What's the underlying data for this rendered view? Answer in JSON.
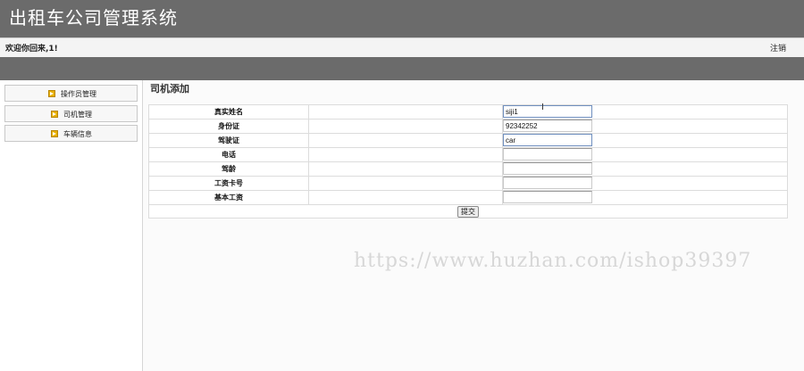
{
  "app": {
    "title": "出租车公司管理系统"
  },
  "welcome": {
    "text": "欢迎你回来,1!",
    "logout_label": "注销"
  },
  "sidebar": {
    "items": [
      {
        "label": "操作员管理"
      },
      {
        "label": "司机管理"
      },
      {
        "label": "车辆信息"
      }
    ]
  },
  "main": {
    "heading": "司机添加",
    "fields": [
      {
        "label": "真实姓名",
        "value": "siji1"
      },
      {
        "label": "身份证",
        "value": "92342252"
      },
      {
        "label": "驾驶证",
        "value": "car"
      },
      {
        "label": "电话",
        "value": ""
      },
      {
        "label": "驾龄",
        "value": ""
      },
      {
        "label": "工资卡号",
        "value": ""
      },
      {
        "label": "基本工资",
        "value": ""
      }
    ],
    "submit_label": "提交"
  },
  "watermark": {
    "text": "https://www.huzhan.com/ishop39397"
  }
}
